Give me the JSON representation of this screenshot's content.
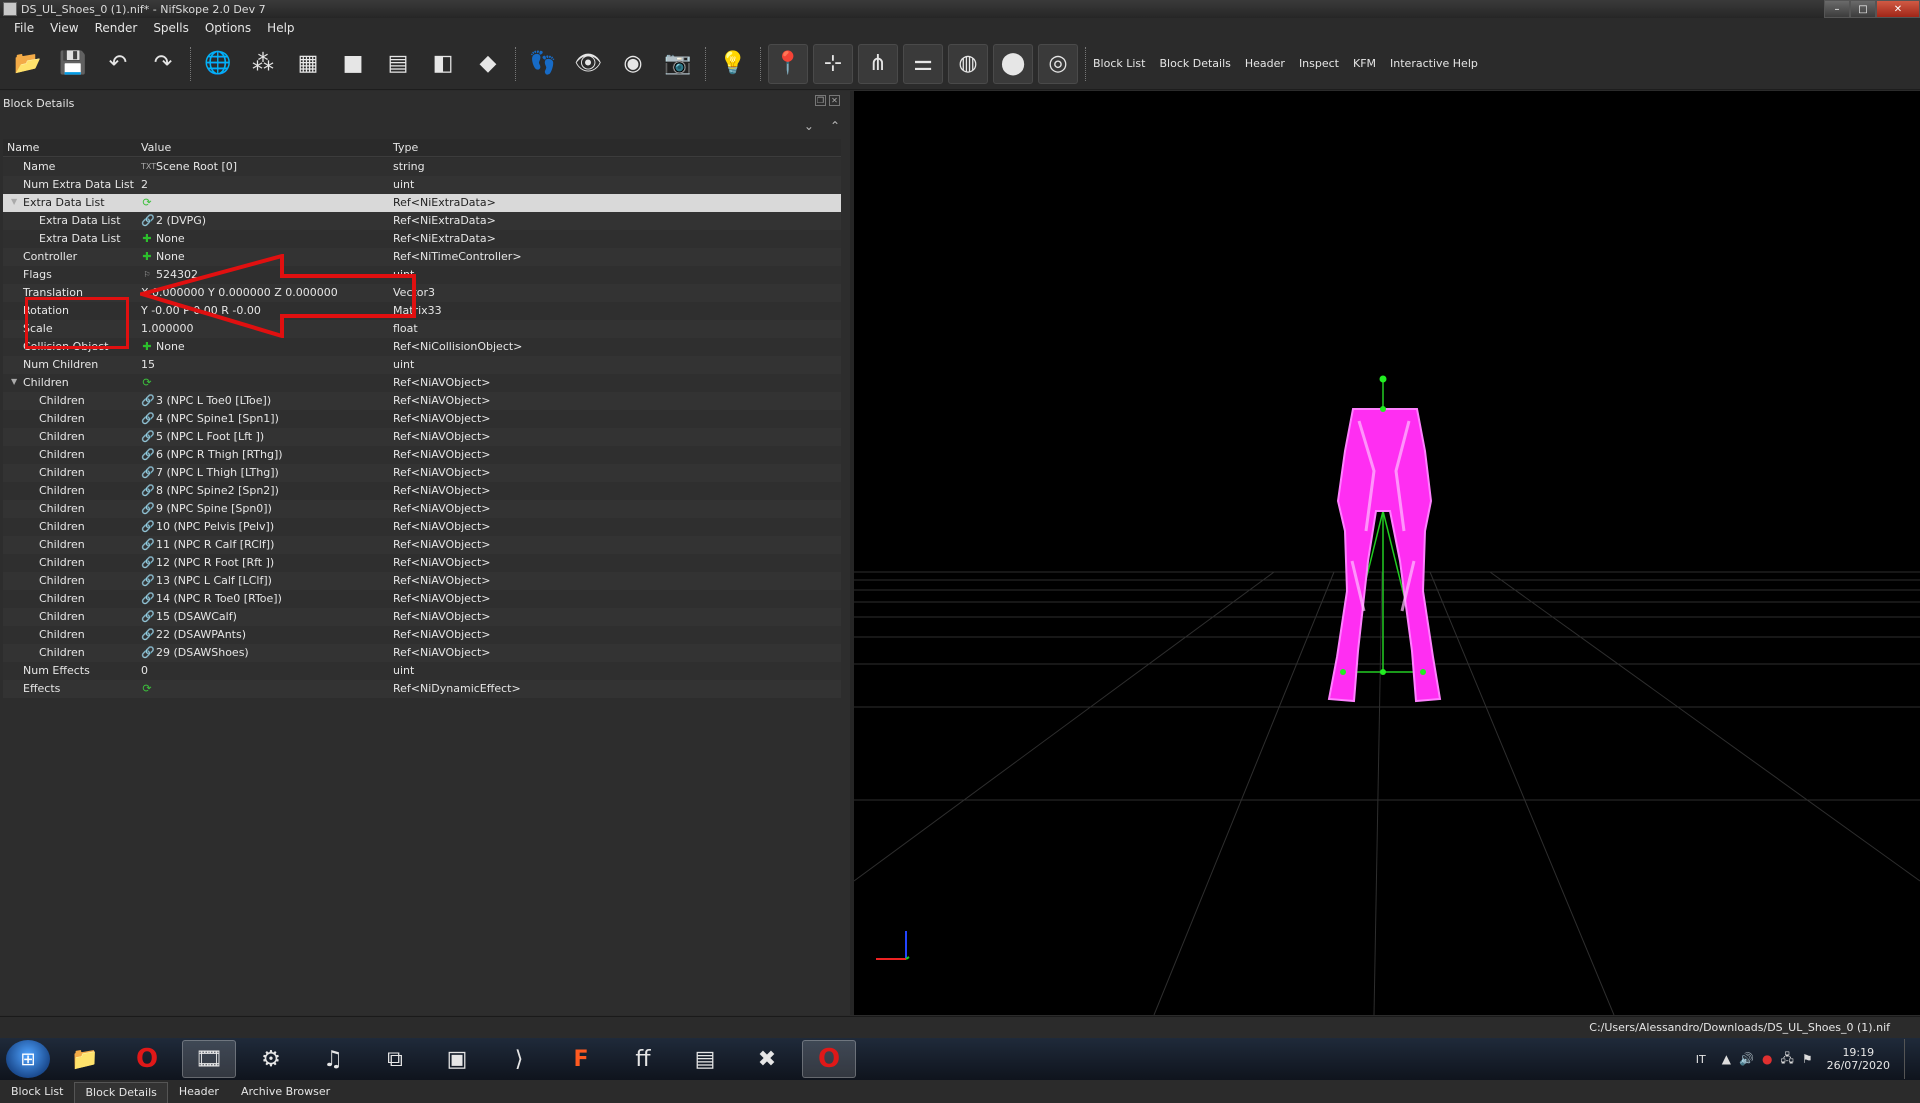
{
  "window": {
    "title": "DS_UL_Shoes_0 (1).nif* - NifSkope 2.0 Dev 7",
    "controls": [
      "–",
      "□",
      "✕"
    ]
  },
  "menu": [
    "File",
    "View",
    "Render",
    "Spells",
    "Options",
    "Help"
  ],
  "toolbar": {
    "buttons": [
      {
        "icon": "open-folder-icon",
        "glyph": "📂"
      },
      {
        "icon": "save-icon",
        "glyph": "💾"
      },
      {
        "icon": "undo-icon",
        "glyph": "↶"
      },
      {
        "icon": "redo-icon",
        "glyph": "↷"
      },
      {
        "icon": "select-object-icon",
        "glyph": "🌐"
      },
      {
        "icon": "select-nodes-icon",
        "glyph": "⁂"
      },
      {
        "icon": "view-front-icon",
        "glyph": "▦"
      },
      {
        "icon": "view-top-icon",
        "glyph": "■"
      },
      {
        "icon": "view-side-icon",
        "glyph": "▤"
      },
      {
        "icon": "view-flip-icon",
        "glyph": "◧"
      },
      {
        "icon": "perspective-icon",
        "glyph": "◆"
      },
      {
        "icon": "walk-mode-icon",
        "glyph": "👣"
      },
      {
        "icon": "show-visible-icon",
        "glyph": "👁"
      },
      {
        "icon": "show-hidden-icon",
        "glyph": "◉"
      },
      {
        "icon": "screenshot-icon",
        "glyph": "📷"
      },
      {
        "icon": "lighting-icon",
        "glyph": "💡"
      },
      {
        "icon": "show-markers-icon",
        "glyph": "📍"
      },
      {
        "icon": "show-axes-icon",
        "glyph": "⊹"
      },
      {
        "icon": "show-nodes-icon",
        "glyph": "⋔"
      },
      {
        "icon": "show-constraints-icon",
        "glyph": "⚌"
      },
      {
        "icon": "show-collision-icon",
        "glyph": "◍"
      },
      {
        "icon": "show-havok-icon",
        "glyph": "⬤"
      },
      {
        "icon": "show-hidden-meshes-icon",
        "glyph": "◎"
      }
    ],
    "dock_tabs": [
      "Block List",
      "Block Details",
      "Header",
      "Inspect",
      "KFM",
      "Interactive Help"
    ]
  },
  "panel": {
    "title": "Block Details",
    "columns": [
      "Name",
      "Value",
      "Type"
    ]
  },
  "rows": [
    {
      "name": "Name",
      "indent": 1,
      "icon": "str",
      "value": "Scene Root [0]",
      "type": "string"
    },
    {
      "name": "Num Extra Data List",
      "indent": 1,
      "icon": "",
      "value": "2",
      "type": "uint"
    },
    {
      "name": "Extra Data List",
      "indent": 1,
      "expander": "▼",
      "icon": "cycle",
      "value": "",
      "type": "Ref<NiExtraData>",
      "selected": true
    },
    {
      "name": "Extra Data List",
      "indent": 2,
      "icon": "link",
      "value": "2 (DVPG)",
      "type": "Ref<NiExtraData>"
    },
    {
      "name": "Extra Data List",
      "indent": 2,
      "icon": "plus",
      "value": "None",
      "type": "Ref<NiExtraData>"
    },
    {
      "name": "Controller",
      "indent": 1,
      "icon": "plus",
      "value": "None",
      "type": "Ref<NiTimeController>"
    },
    {
      "name": "Flags",
      "indent": 1,
      "icon": "flag",
      "value": "524302",
      "type": "uint"
    },
    {
      "name": "Translation",
      "indent": 1,
      "icon": "",
      "value": "X 0.000000 Y 0.000000 Z 0.000000",
      "type": "Vector3"
    },
    {
      "name": "Rotation",
      "indent": 1,
      "icon": "",
      "value": "Y -0.00 P 0.00 R -0.00",
      "type": "Matrix33"
    },
    {
      "name": "Scale",
      "indent": 1,
      "icon": "",
      "value": "1.000000",
      "type": "float"
    },
    {
      "name": "Collision Object",
      "indent": 1,
      "icon": "plus",
      "value": "None",
      "type": "Ref<NiCollisionObject>"
    },
    {
      "name": "Num Children",
      "indent": 1,
      "icon": "",
      "value": "15",
      "type": "uint"
    },
    {
      "name": "Children",
      "indent": 1,
      "expander": "▼",
      "icon": "cycle",
      "value": "",
      "type": "Ref<NiAVObject>"
    },
    {
      "name": "Children",
      "indent": 2,
      "icon": "link",
      "value": "3 (NPC L Toe0 [LToe])",
      "type": "Ref<NiAVObject>"
    },
    {
      "name": "Children",
      "indent": 2,
      "icon": "link",
      "value": "4 (NPC Spine1 [Spn1])",
      "type": "Ref<NiAVObject>"
    },
    {
      "name": "Children",
      "indent": 2,
      "icon": "link",
      "value": "5 (NPC L Foot [Lft ])",
      "type": "Ref<NiAVObject>"
    },
    {
      "name": "Children",
      "indent": 2,
      "icon": "link",
      "value": "6 (NPC R Thigh [RThg])",
      "type": "Ref<NiAVObject>"
    },
    {
      "name": "Children",
      "indent": 2,
      "icon": "link",
      "value": "7 (NPC L Thigh [LThg])",
      "type": "Ref<NiAVObject>"
    },
    {
      "name": "Children",
      "indent": 2,
      "icon": "link",
      "value": "8 (NPC Spine2 [Spn2])",
      "type": "Ref<NiAVObject>"
    },
    {
      "name": "Children",
      "indent": 2,
      "icon": "link",
      "value": "9 (NPC Spine [Spn0])",
      "type": "Ref<NiAVObject>"
    },
    {
      "name": "Children",
      "indent": 2,
      "icon": "link",
      "value": "10 (NPC Pelvis [Pelv])",
      "type": "Ref<NiAVObject>"
    },
    {
      "name": "Children",
      "indent": 2,
      "icon": "link",
      "value": "11 (NPC R Calf [RClf])",
      "type": "Ref<NiAVObject>"
    },
    {
      "name": "Children",
      "indent": 2,
      "icon": "link",
      "value": "12 (NPC R Foot [Rft ])",
      "type": "Ref<NiAVObject>"
    },
    {
      "name": "Children",
      "indent": 2,
      "icon": "link",
      "value": "13 (NPC L Calf [LClf])",
      "type": "Ref<NiAVObject>"
    },
    {
      "name": "Children",
      "indent": 2,
      "icon": "link",
      "value": "14 (NPC R Toe0 [RToe])",
      "type": "Ref<NiAVObject>"
    },
    {
      "name": "Children",
      "indent": 2,
      "icon": "link",
      "value": "15 (DSAWCalf)",
      "type": "Ref<NiAVObject>"
    },
    {
      "name": "Children",
      "indent": 2,
      "icon": "link",
      "value": "22 (DSAWPAnts)",
      "type": "Ref<NiAVObject>"
    },
    {
      "name": "Children",
      "indent": 2,
      "icon": "link",
      "value": "29 (DSAWShoes)",
      "type": "Ref<NiAVObject>"
    },
    {
      "name": "Num Effects",
      "indent": 1,
      "icon": "",
      "value": "0",
      "type": "uint"
    },
    {
      "name": "Effects",
      "indent": 1,
      "icon": "cycle",
      "value": "",
      "type": "Ref<NiDynamicEffect>"
    }
  ],
  "bottom_tabs": [
    {
      "label": "Block List",
      "active": false
    },
    {
      "label": "Block Details",
      "active": true
    },
    {
      "label": "Header",
      "active": false
    },
    {
      "label": "Archive Browser",
      "active": false
    }
  ],
  "status": {
    "path": "C:/Users/Alessandro/Downloads/DS_UL_Shoes_0 (1).nif"
  },
  "taskbar": {
    "apps": [
      {
        "icon": "file-explorer-icon",
        "glyph": "📁",
        "active": false
      },
      {
        "icon": "opera-browser-icon",
        "glyph": "O",
        "active": false
      },
      {
        "icon": "media-player-icon",
        "glyph": "🎞",
        "active": true
      },
      {
        "icon": "settings-wheel-icon",
        "glyph": "⚙",
        "active": false
      },
      {
        "icon": "music-player-icon",
        "glyph": "♫",
        "active": false
      },
      {
        "icon": "audio-editor-icon",
        "glyph": "⧉",
        "active": false
      },
      {
        "icon": "paint-tool-icon",
        "glyph": "▣",
        "active": false
      },
      {
        "icon": "bracket-app-icon",
        "glyph": "⟩",
        "active": false
      },
      {
        "icon": "f-app-icon",
        "glyph": "F",
        "active": false
      },
      {
        "icon": "ffdec-icon",
        "glyph": "ff",
        "active": false
      },
      {
        "icon": "window-app-icon",
        "glyph": "▤",
        "active": false
      },
      {
        "icon": "x-app-icon",
        "glyph": "✖",
        "active": false
      },
      {
        "icon": "opera-browser-icon",
        "glyph": "O",
        "active": true
      }
    ],
    "language": "IT",
    "time": "19:19",
    "date": "26/07/2020"
  },
  "colors": {
    "mesh": "#ff33ff",
    "grid": "#2a2a2a",
    "bone": "#22cc22",
    "annotation": "#e01010"
  }
}
